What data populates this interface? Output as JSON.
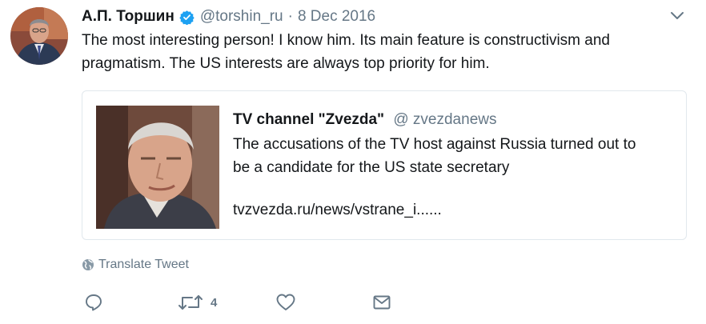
{
  "author": {
    "name": "А.П. Торшин",
    "handle": "@torshin_ru",
    "separator": "·",
    "date": "8 Dec 2016"
  },
  "tweet": {
    "lines": [
      "The most interesting person! I know him. Its main feature is constructivism and",
      "pragmatism. The US interests are always top priority for him."
    ]
  },
  "quoted": {
    "name": "TV channel \"Zvezda\"",
    "handle": "@ zvezdanews",
    "lines": [
      "The accusations of the TV host against Russia turned out to",
      "be a candidate for the US state secretary"
    ],
    "link": "tvzvezda.ru/news/vstrane_i......"
  },
  "translate_label": "Translate Tweet",
  "actions": {
    "retweet_count": "4"
  },
  "icons": {
    "verified": "verified-badge-icon",
    "caret": "chevron-down-icon",
    "translate": "globe-icon",
    "reply": "reply-icon",
    "retweet": "retweet-icon",
    "like": "heart-icon",
    "message": "envelope-icon"
  },
  "colors": {
    "verified": "#1da1f2",
    "muted": "#657786",
    "text": "#14171a",
    "border": "#e1e8ed"
  }
}
